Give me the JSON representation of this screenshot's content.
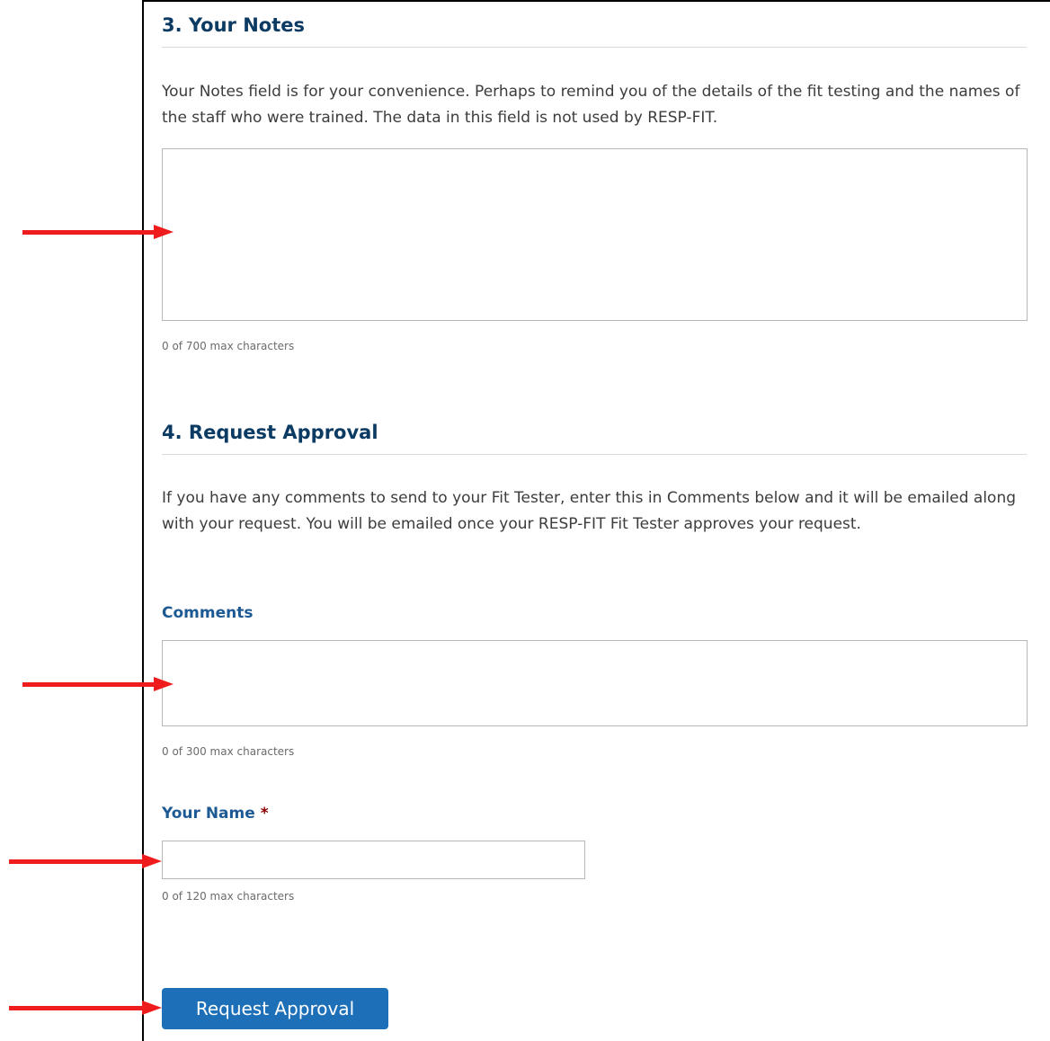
{
  "notes_section": {
    "heading": "3. Your Notes",
    "description": "Your Notes field is for your convenience. Perhaps to remind you of the details of the fit testing and the names of the staff who were trained. The data in this field is not used by RESP-FIT.",
    "notes_value": "",
    "counter": "0 of 700 max characters"
  },
  "approval_section": {
    "heading": "4. Request Approval",
    "description": "If you have any comments to send to your Fit Tester, enter this in Comments below and it will be emailed along with your request. You will be emailed once your RESP-FIT Fit Tester approves your request.",
    "comments": {
      "label": "Comments",
      "value": "",
      "counter": "0 of 300 max characters"
    },
    "name": {
      "label": "Your Name",
      "required_marker": "*",
      "value": "",
      "counter": "0 of 120 max characters"
    },
    "submit_label": "Request Approval"
  },
  "annotations": {
    "arrow_color": "#ee1c1c",
    "arrow_icon": "red-arrow-right-icon"
  },
  "colors": {
    "heading": "#0b3a63",
    "label": "#1d5a94",
    "button": "#1d6fb8",
    "required": "#8b0000"
  }
}
